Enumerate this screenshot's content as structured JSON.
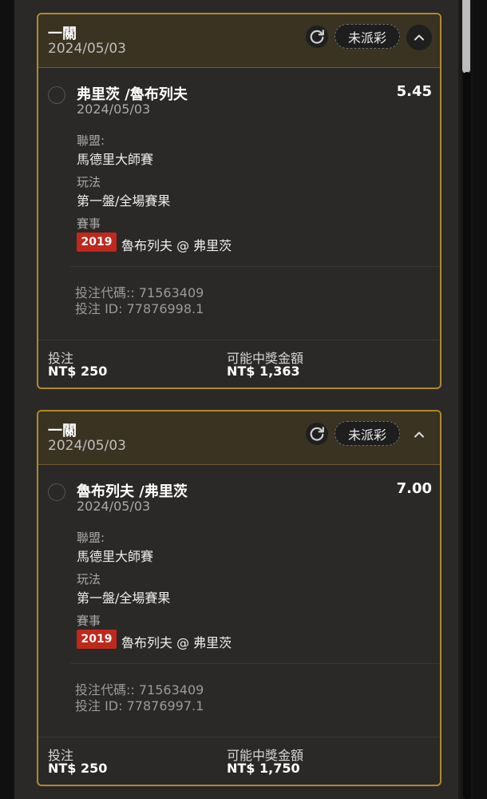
{
  "cards": [
    {
      "title": "一關",
      "date": "2024/05/03",
      "status": "未派彩",
      "bet": {
        "match": "弗里茨 /魯布列夫",
        "odds": "5.45",
        "date": "2024/05/03",
        "league_label": "聯盟:",
        "league": "馬德里大師賽",
        "market_label": "玩法",
        "market": "第一盤/全場賽果",
        "event_label": "賽事",
        "event_year": "2019",
        "event": "魯布列夫 @ 弗里茨",
        "bet_code": "投注代碼:: 71563409",
        "bet_id": "投注 ID: 77876998.1"
      },
      "stake_label": "投注",
      "stake": "NT$ 250",
      "payout_label": "可能中獎金額",
      "payout": "NT$ 1,363"
    },
    {
      "title": "一關",
      "date": "2024/05/03",
      "status": "未派彩",
      "bet": {
        "match": "魯布列夫 /弗里茨",
        "odds": "7.00",
        "date": "2024/05/03",
        "league_label": "聯盟:",
        "league": "馬德里大師賽",
        "market_label": "玩法",
        "market": "第一盤/全場賽果",
        "event_label": "賽事",
        "event_year": "2019",
        "event": "魯布列夫 @ 弗里茨",
        "bet_code": "投注代碼:: 71563409",
        "bet_id": "投注 ID: 77876997.1"
      },
      "stake_label": "投注",
      "stake": "NT$ 250",
      "payout_label": "可能中獎金額",
      "payout": "NT$ 1,750"
    }
  ],
  "colors": {
    "accent_border": "#b0892e",
    "year_badge": "#c0281c",
    "header_bg": "#3a3322",
    "card_bg": "#2a2927"
  },
  "icons": {
    "refresh": "refresh-icon",
    "collapse": "chevron-up-icon"
  }
}
